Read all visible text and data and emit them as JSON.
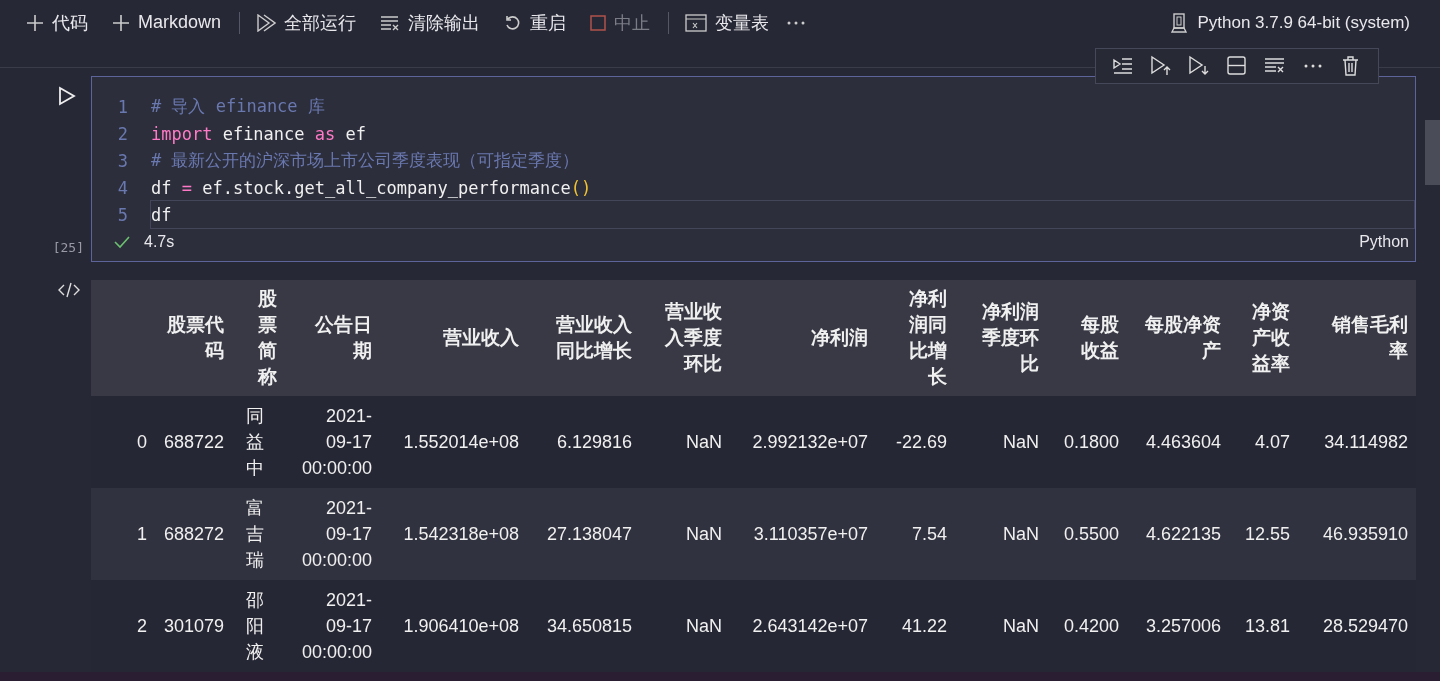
{
  "toolbar": {
    "items": [
      {
        "kind": "add",
        "label": "代码",
        "disabled": false
      },
      {
        "kind": "add",
        "label": "Markdown",
        "disabled": false
      },
      {
        "kind": "run-all",
        "label": "全部运行",
        "disabled": false
      },
      {
        "kind": "clear",
        "label": "清除输出",
        "disabled": false
      },
      {
        "kind": "restart",
        "label": "重启",
        "disabled": false
      },
      {
        "kind": "stop",
        "label": "中止",
        "disabled": true
      },
      {
        "kind": "variables",
        "label": "变量表",
        "disabled": false
      },
      {
        "kind": "more"
      }
    ],
    "kernel": "Python 3.7.9 64-bit (system)"
  },
  "cell": {
    "execution_count": "[25]",
    "succeeded": true,
    "duration": "4.7s",
    "language": "Python",
    "lines": [
      {
        "number": "1",
        "active": false,
        "tokens": [
          {
            "kind": "comment",
            "text": "# 导入 efinance 库"
          }
        ]
      },
      {
        "number": "2",
        "active": false,
        "tokens": [
          {
            "kind": "keyword",
            "text": "import"
          },
          {
            "kind": "plain",
            "text": " efinance "
          },
          {
            "kind": "keyword",
            "text": "as"
          },
          {
            "kind": "plain",
            "text": " ef"
          }
        ]
      },
      {
        "number": "3",
        "active": false,
        "tokens": [
          {
            "kind": "comment",
            "text": "# 最新公开的沪深市场上市公司季度表现（可指定季度）"
          }
        ]
      },
      {
        "number": "4",
        "active": false,
        "tokens": [
          {
            "kind": "plain",
            "text": "df "
          },
          {
            "kind": "operator",
            "text": "="
          },
          {
            "kind": "plain",
            "text": " ef.stock.get_all_company_performance"
          },
          {
            "kind": "bracket",
            "text": "()"
          }
        ]
      },
      {
        "number": "5",
        "active": true,
        "tokens": [
          {
            "kind": "plain",
            "text": "df"
          }
        ]
      }
    ]
  },
  "output": {
    "table": {
      "columns": [
        "股票代码",
        "股票简称",
        "公告日期",
        "营业收入",
        "营业收入同比增长",
        "营业收入季度环比",
        "净利润",
        "净利润同比增长",
        "净利润季度环比",
        "每股收益",
        "每股净资产",
        "净资产收益率",
        "销售毛利率"
      ],
      "rows": [
        {
          "index": "0",
          "cells": [
            "688722",
            "同益中",
            "2021-09-17 00:00:00",
            "1.552014e+08",
            "6.129816",
            "NaN",
            "2.992132e+07",
            "-22.69",
            "NaN",
            "0.1800",
            "4.463604",
            "4.07",
            "34.114982"
          ]
        },
        {
          "index": "1",
          "cells": [
            "688272",
            "富吉瑞",
            "2021-09-17 00:00:00",
            "1.542318e+08",
            "27.138047",
            "NaN",
            "3.110357e+07",
            "7.54",
            "NaN",
            "0.5500",
            "4.622135",
            "12.55",
            "46.935910"
          ]
        },
        {
          "index": "2",
          "cells": [
            "301079",
            "邵阳液",
            "2021-09-17 00:00:00",
            "1.906410e+08",
            "34.650815",
            "NaN",
            "2.643142e+07",
            "41.22",
            "NaN",
            "0.4200",
            "3.257006",
            "13.81",
            "28.529470"
          ]
        }
      ]
    }
  }
}
